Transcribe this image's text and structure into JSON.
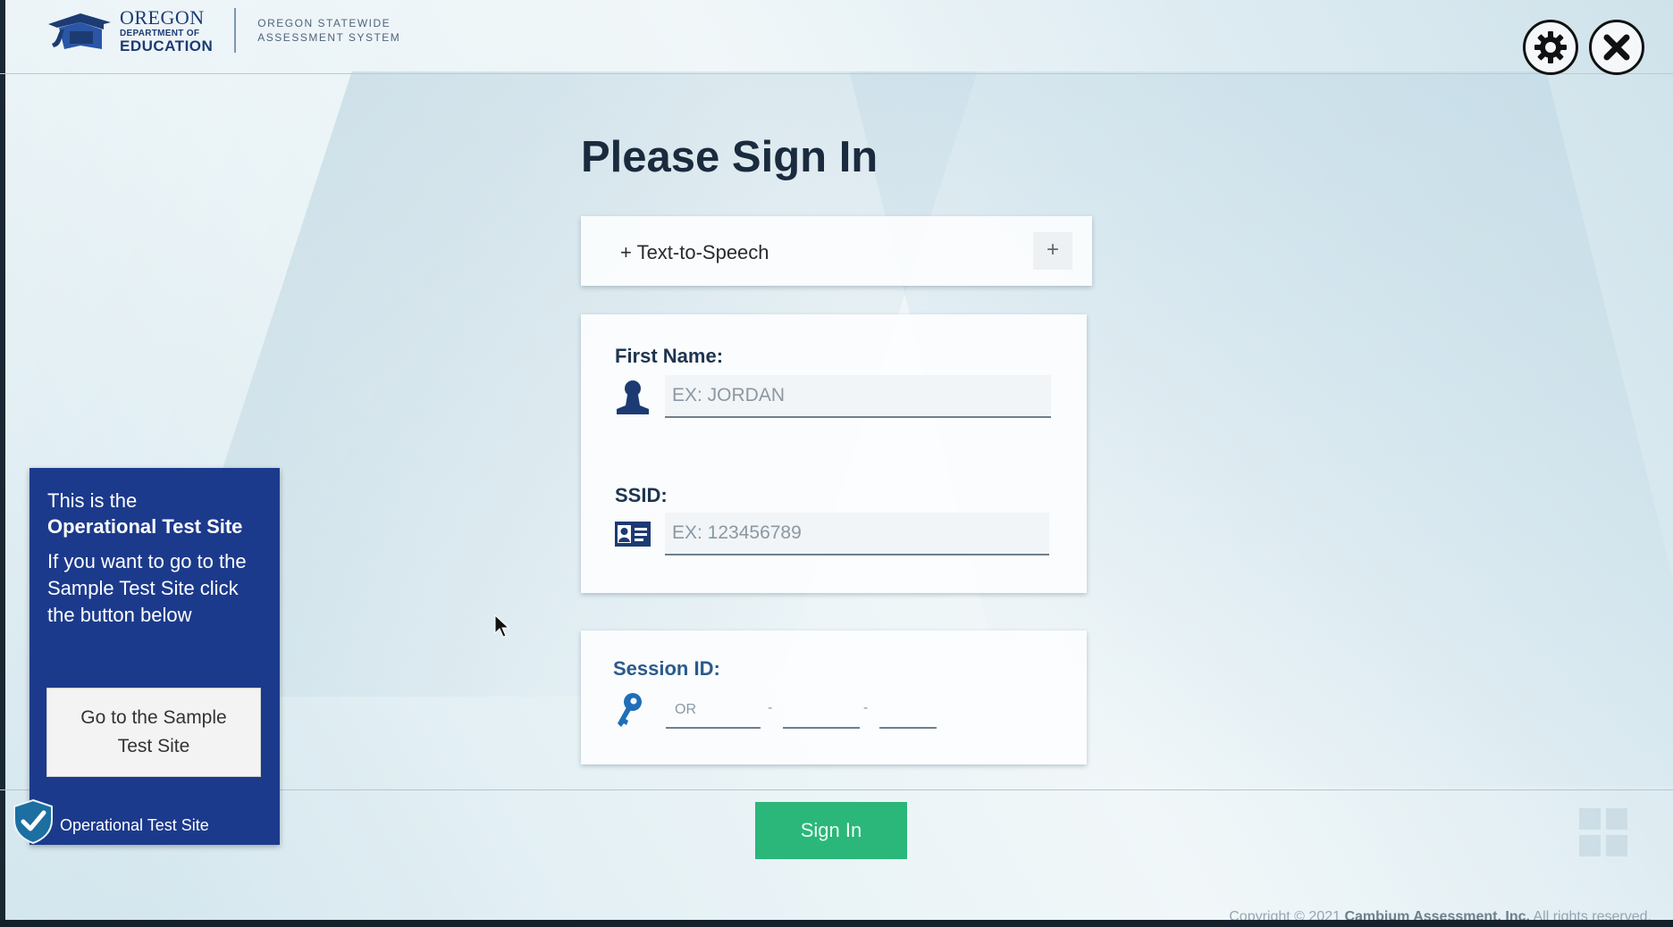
{
  "header": {
    "logo": {
      "line1": "OREGON",
      "line2": "DEPARTMENT OF",
      "line3": "EDUCATION"
    },
    "system_name_line1": "OREGON STATEWIDE",
    "system_name_line2": "ASSESSMENT SYSTEM",
    "settings_icon": "gear-icon",
    "close_icon": "close-icon"
  },
  "main": {
    "title": "Please Sign In",
    "tts": {
      "label": "+ Text-to-Speech",
      "expand": "+"
    },
    "first_name": {
      "label": "First Name:",
      "placeholder": "EX: JORDAN",
      "icon": "person-icon"
    },
    "ssid": {
      "label": "SSID:",
      "placeholder": "EX: 123456789",
      "icon": "id-card-icon"
    },
    "session": {
      "label": "Session ID:",
      "seg1_value": "OR",
      "separator": "-",
      "icon": "key-icon"
    },
    "sign_in_label": "Sign In"
  },
  "notice": {
    "line1": "This is the",
    "line2": "Operational Test Site",
    "line3": "If you want to go to the Sample Test Site click the button below",
    "button_label": "Go to the Sample Test Site",
    "site_label": "Operational Test Site",
    "badge_icon": "shield-check-icon"
  },
  "footer": {
    "copyright_prefix": "Copyright © 2021 ",
    "company": "Cambium Assessment, Inc.",
    "copyright_suffix": " All rights reserved."
  },
  "colors": {
    "brand_navy": "#1c3a8c",
    "sign_in_green": "#2bb67a",
    "title_text": "#1a2b3e"
  }
}
